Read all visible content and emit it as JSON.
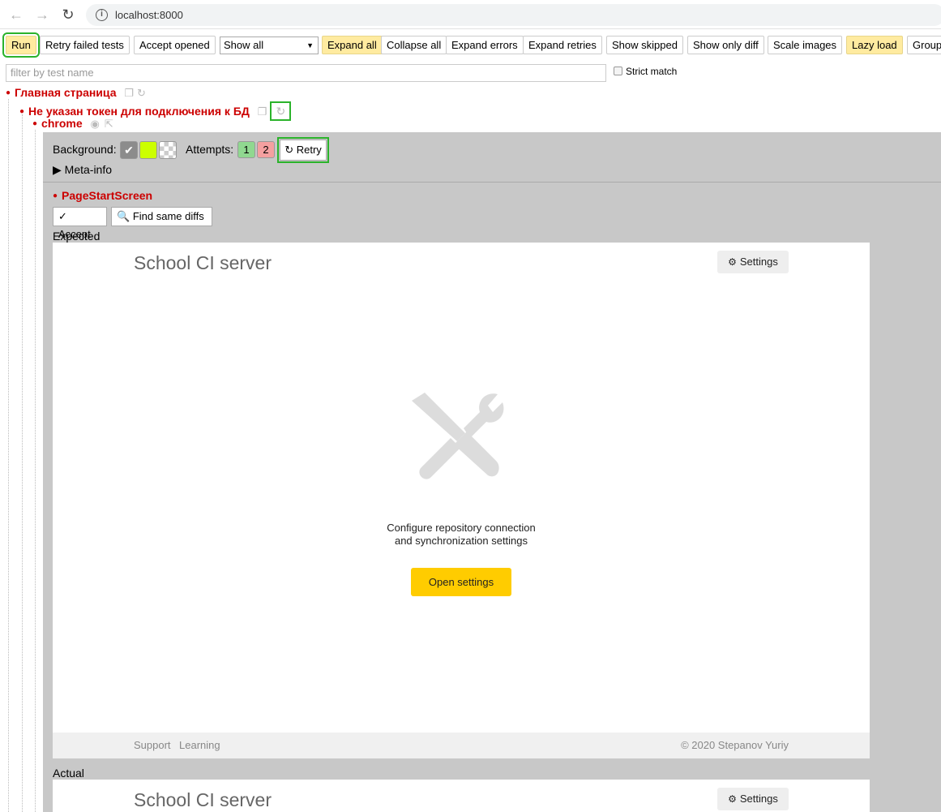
{
  "browser": {
    "url": "localhost:8000"
  },
  "toolbar": {
    "run": "Run",
    "retry_failed": "Retry failed tests",
    "accept_opened": "Accept opened",
    "show_select": "Show all",
    "expand_all": "Expand all",
    "collapse_all": "Collapse all",
    "expand_errors": "Expand errors",
    "expand_retries": "Expand retries",
    "show_skipped": "Show skipped",
    "show_only_diff": "Show only diff",
    "scale_images": "Scale images",
    "lazy_load": "Lazy load",
    "group": "Group"
  },
  "filter": {
    "placeholder": "filter by test name",
    "strict_match": "Strict match"
  },
  "tree": {
    "suite": "Главная страница",
    "test": "Не указан токен для подключения к БД",
    "browser": "chrome"
  },
  "panel": {
    "background_label": "Background:",
    "attempts_label": "Attempts:",
    "attempt_1": "1",
    "attempt_2": "2",
    "retry": "↻ Retry",
    "meta_info": "▶  Meta-info",
    "state_name": "PageStartScreen",
    "accept": "✓ Accept",
    "find_same_diffs": "Find same diffs",
    "expected_label": "Expected",
    "actual_label": "Actual"
  },
  "screenshot": {
    "title": "School CI server",
    "settings": "Settings",
    "config_line1": "Configure repository connection",
    "config_line2": "and synchronization settings",
    "open_settings": "Open settings",
    "footer_support": "Support",
    "footer_learning": "Learning",
    "footer_copyright": "© 2020 Stepanov Yuriy"
  }
}
